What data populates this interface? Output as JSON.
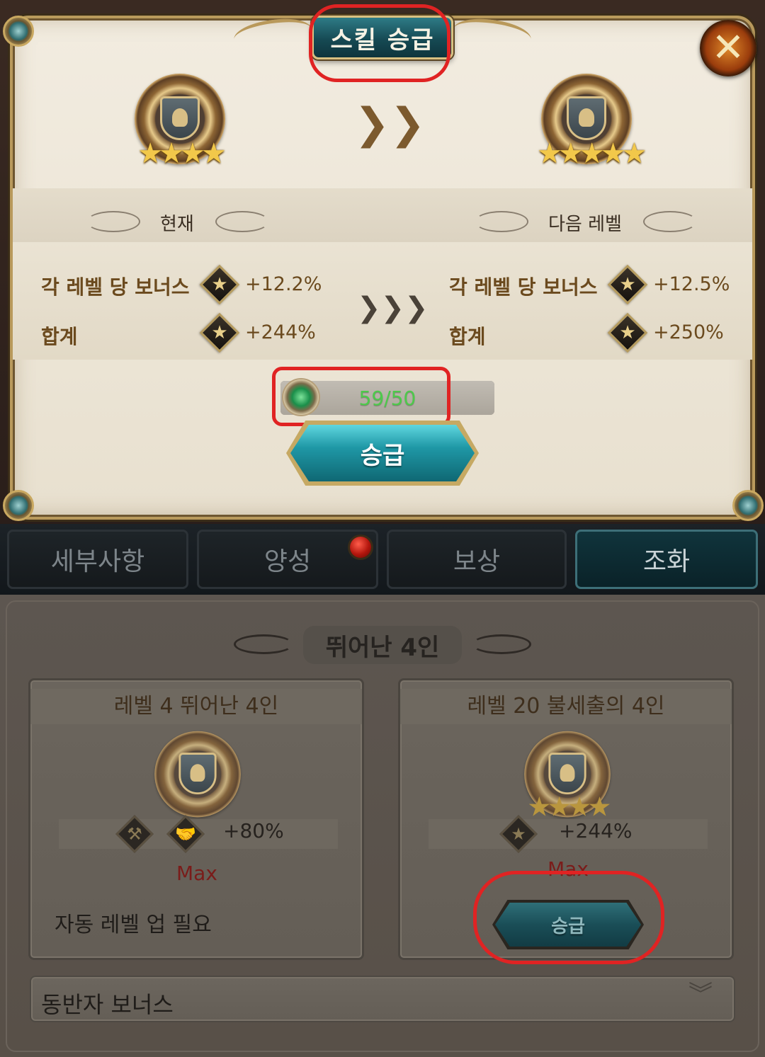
{
  "dialog": {
    "title": "스킬 승급",
    "close_icon": "close-icon"
  },
  "current": {
    "header": "현재",
    "stars": "★★★★",
    "bonus_label": "각 레벨 당 보너스",
    "bonus_value": "+12.2%",
    "total_label": "합계",
    "total_value": "+244%"
  },
  "next": {
    "header": "다음 레벨",
    "stars": "★★★★★",
    "bonus_label": "각 레벨 당 보너스",
    "bonus_value": "+12.5%",
    "total_label": "합계",
    "total_value": "+250%"
  },
  "arrows": {
    "level_arrow": "❯❯",
    "stats_arrow": "❯❯❯"
  },
  "progress": {
    "text": "59/50",
    "fraction": 1.0
  },
  "upgrade_button": "승급",
  "tabs": [
    {
      "label": "세부사항"
    },
    {
      "label": "양성"
    },
    {
      "label": "보상"
    },
    {
      "label": "조화"
    }
  ],
  "section": {
    "title": "뛰어난 4인"
  },
  "cards": [
    {
      "title": "레벨 4 뛰어난 4인",
      "value": "+80%",
      "status": "Max",
      "note": "자동 레벨 업 필요",
      "stars": ""
    },
    {
      "title": "레벨 20 불세출의 4인",
      "value": "+244%",
      "status": "Max",
      "button": "승급",
      "stars": "★★★★"
    }
  ],
  "companion_bonus": {
    "label": "동반자 보너스",
    "icon": "chevron-down-icon"
  },
  "colors": {
    "annotation": "#e02323",
    "accent_teal": "#1f98a6",
    "progress_text": "#4ec94b",
    "max_text": "#7a1c1a"
  }
}
